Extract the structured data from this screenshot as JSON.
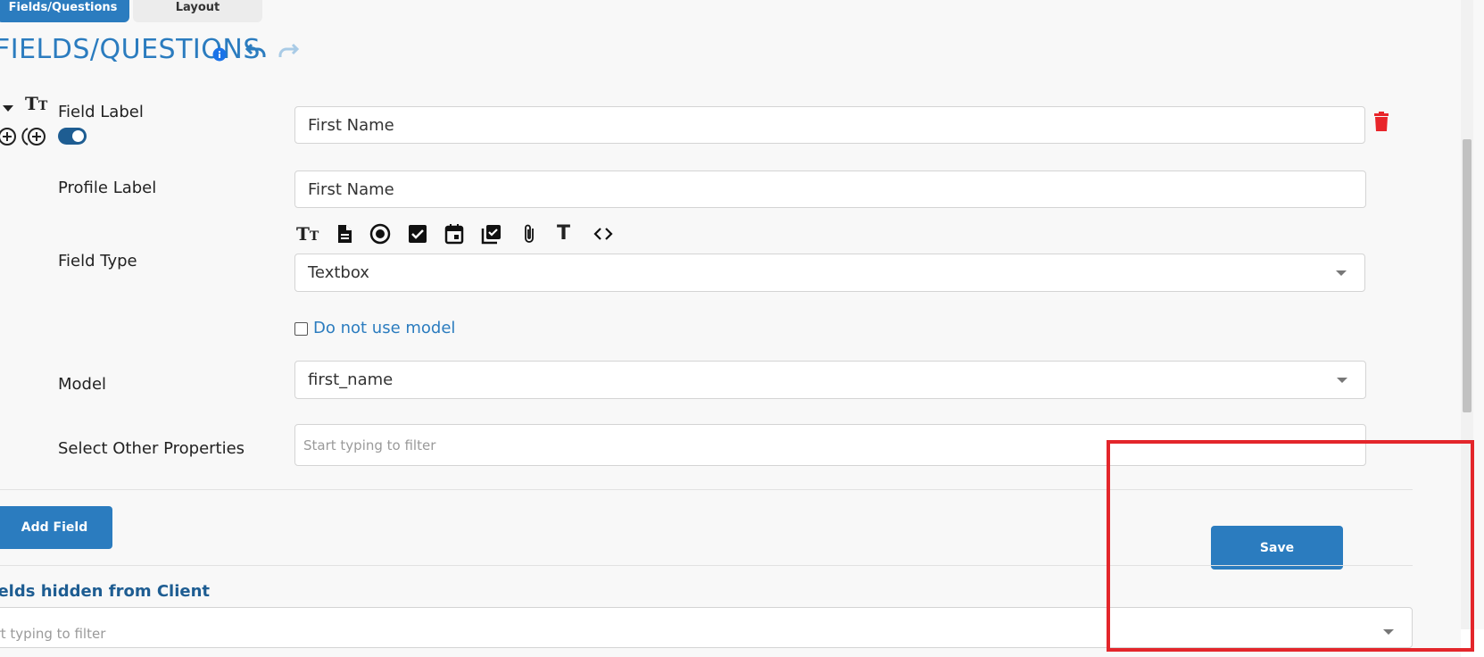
{
  "tabs": {
    "fields_questions": "Fields/Questions",
    "layout": "Layout"
  },
  "header": {
    "title": "FIELDS/QUESTIONS"
  },
  "field": {
    "field_label": {
      "label": "Field Label",
      "value": "First Name"
    },
    "profile_label": {
      "label": "Profile Label",
      "value": "First Name"
    },
    "field_type": {
      "label": "Field Type",
      "value": "Textbox",
      "type_icons": [
        "text-size-icon",
        "document-icon",
        "radio-icon",
        "checkbox-icon",
        "calendar-icon",
        "checklist-icon",
        "attachment-icon",
        "text-icon",
        "code-icon"
      ]
    },
    "do_not_use_model": "Do not use model",
    "model": {
      "label": "Model",
      "value": "first_name"
    },
    "other_properties": {
      "label": "Select Other Properties",
      "placeholder": "Start typing to filter"
    }
  },
  "actions": {
    "add_field": "Add Field",
    "save": "Save"
  },
  "hidden_section": {
    "title": "Fields hidden from Client",
    "placeholder": "Start typing to filter"
  },
  "colors": {
    "accent": "#2b7cbf",
    "delete": "#e8252a",
    "highlight": "#e3262b",
    "toggle": "#1e5d92"
  }
}
